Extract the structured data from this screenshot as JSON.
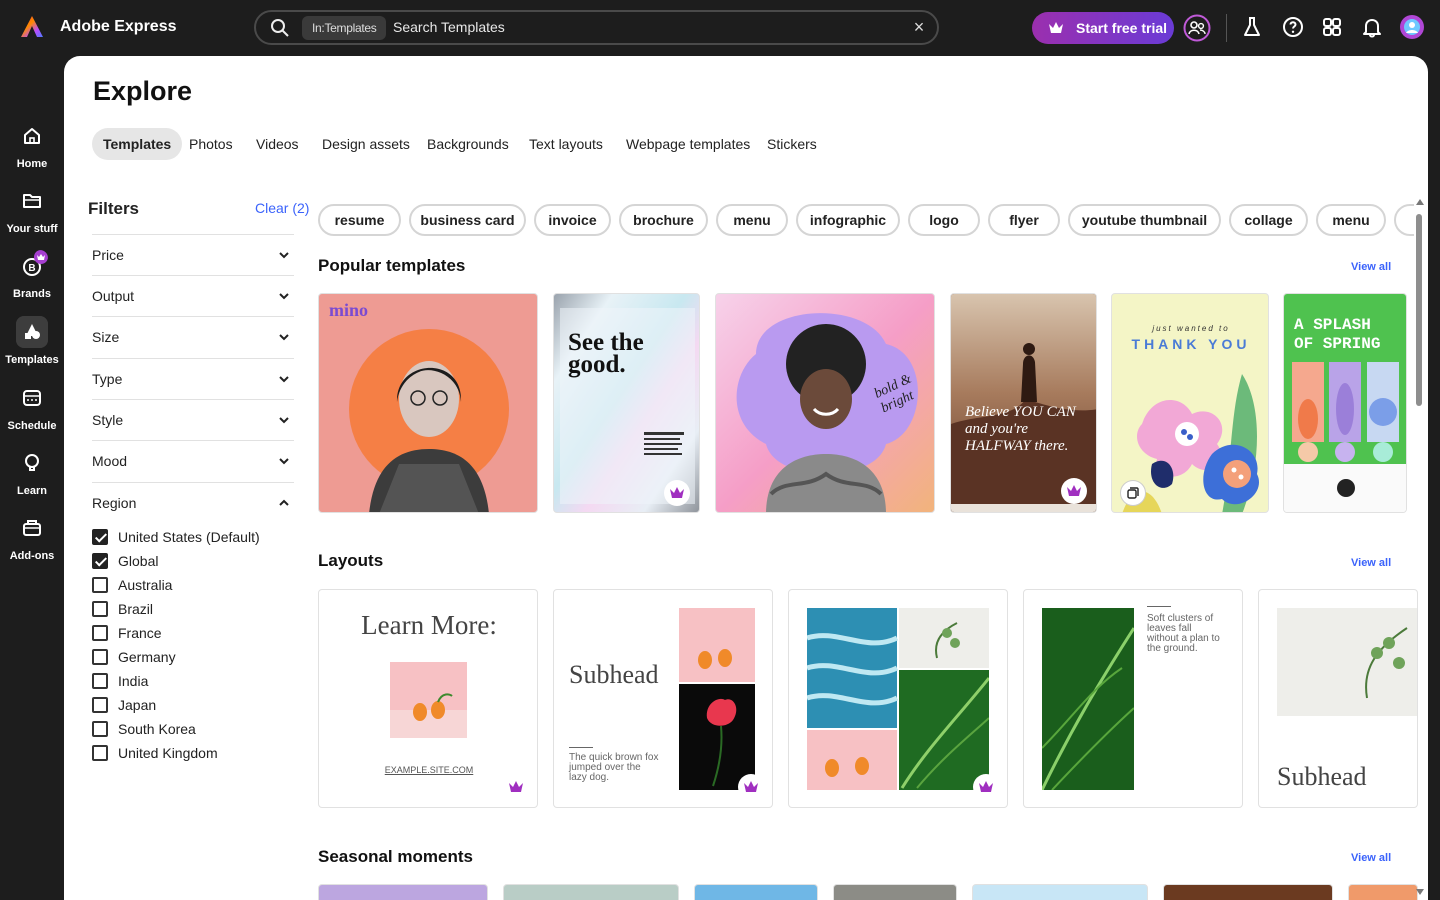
{
  "app": {
    "name": "Adobe Express"
  },
  "search": {
    "scope_chip": "In:Templates",
    "placeholder": "Search Templates"
  },
  "header": {
    "trial_label": "Start free trial"
  },
  "rail": {
    "items": [
      {
        "label": "Home"
      },
      {
        "label": "Your stuff"
      },
      {
        "label": "Brands"
      },
      {
        "label": "Templates"
      },
      {
        "label": "Schedule"
      },
      {
        "label": "Learn"
      },
      {
        "label": "Add-ons"
      }
    ]
  },
  "page": {
    "title": "Explore"
  },
  "tabs": [
    "Templates",
    "Photos",
    "Videos",
    "Design assets",
    "Backgrounds",
    "Text layouts",
    "Webpage templates",
    "Stickers"
  ],
  "filters": {
    "title": "Filters",
    "clear_label": "Clear (2)",
    "groups": [
      "Price",
      "Output",
      "Size",
      "Type",
      "Style",
      "Mood",
      "Region"
    ],
    "regions": [
      {
        "label": "United States (Default)",
        "checked": true
      },
      {
        "label": "Global",
        "checked": true
      },
      {
        "label": "Australia",
        "checked": false
      },
      {
        "label": "Brazil",
        "checked": false
      },
      {
        "label": "France",
        "checked": false
      },
      {
        "label": "Germany",
        "checked": false
      },
      {
        "label": "India",
        "checked": false
      },
      {
        "label": "Japan",
        "checked": false
      },
      {
        "label": "South Korea",
        "checked": false
      },
      {
        "label": "United Kingdom",
        "checked": false
      }
    ]
  },
  "pills": [
    "resume",
    "business card",
    "invoice",
    "brochure",
    "menu",
    "infographic",
    "logo",
    "flyer",
    "youtube thumbnail",
    "collage",
    "menu"
  ],
  "sections": {
    "popular": {
      "title": "Popular templates",
      "view_all": "View all"
    },
    "layouts": {
      "title": "Layouts",
      "view_all": "View all"
    },
    "seasonal": {
      "title": "Seasonal moments",
      "view_all": "View all"
    }
  },
  "templates": {
    "t1_brand": "mino",
    "t2_headline": "See the good.",
    "t3_script": "bold & bright",
    "t4_quote": "Believe YOU CAN and you're HALFWAY there.",
    "t5_small": "just wanted to",
    "t5_big": "THANK YOU",
    "t6_title": "A SPLASH OF SPRING"
  },
  "layouts": {
    "l1_title": "Learn More:",
    "l1_url": "EXAMPLE.SITE.COM",
    "l2_title": "Subhead",
    "l2_body": "The quick brown fox jumped over the lazy dog.",
    "l4_body": "Soft clusters of leaves fall without a plan to the ground.",
    "l5_title": "Subhead"
  },
  "colors": {
    "accent": "#3b63fb",
    "premium": "#8d2bb5",
    "rail_bg": "#1d1d1d"
  }
}
